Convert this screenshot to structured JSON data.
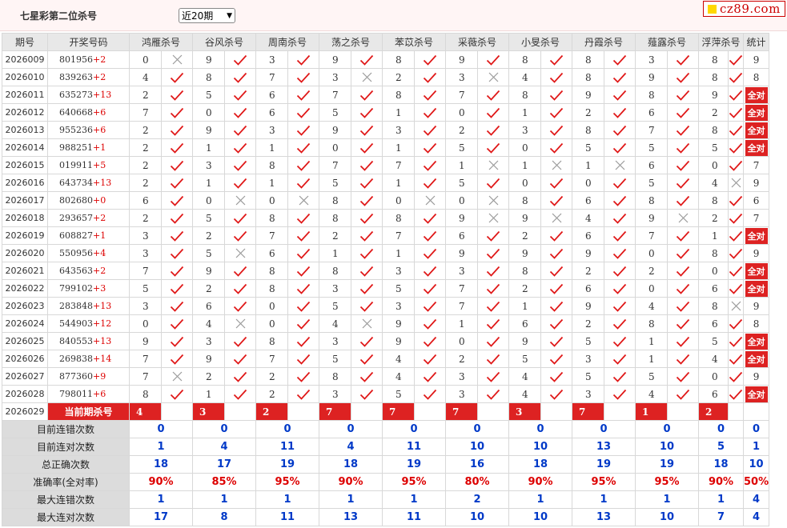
{
  "header": {
    "title": "七星彩第二位杀号",
    "period_select": "近20期",
    "logo_text": "cz89.com"
  },
  "table": {
    "headers": [
      "期号",
      "开奖号码",
      "鸿雁杀号",
      "谷风杀号",
      "周南杀号",
      "荡之杀号",
      "苯苡杀号",
      "采薇杀号",
      "小旻杀号",
      "丹霞杀号",
      "薤露杀号",
      "浮萍杀号",
      "统计"
    ],
    "rows": [
      {
        "period": "2026009",
        "digits": "801956",
        "add": "+2",
        "kills": [
          "0",
          "9",
          "3",
          "9",
          "8",
          "9",
          "8",
          "8",
          "3",
          "8"
        ],
        "marks": [
          0,
          1,
          1,
          1,
          1,
          1,
          1,
          1,
          1,
          1
        ],
        "stat": "9"
      },
      {
        "period": "2026010",
        "digits": "839263",
        "add": "+2",
        "kills": [
          "4",
          "8",
          "7",
          "3",
          "2",
          "3",
          "4",
          "8",
          "9",
          "8"
        ],
        "marks": [
          1,
          1,
          1,
          0,
          1,
          0,
          1,
          1,
          1,
          1
        ],
        "stat": "8"
      },
      {
        "period": "2026011",
        "digits": "635273",
        "add": "+13",
        "kills": [
          "2",
          "5",
          "6",
          "7",
          "8",
          "7",
          "8",
          "9",
          "8",
          "9"
        ],
        "marks": [
          1,
          1,
          1,
          1,
          1,
          1,
          1,
          1,
          1,
          1
        ],
        "stat": "全对"
      },
      {
        "period": "2026012",
        "digits": "640668",
        "add": "+6",
        "kills": [
          "7",
          "0",
          "6",
          "5",
          "1",
          "0",
          "1",
          "2",
          "6",
          "2"
        ],
        "marks": [
          1,
          1,
          1,
          1,
          1,
          1,
          1,
          1,
          1,
          1
        ],
        "stat": "全对"
      },
      {
        "period": "2026013",
        "digits": "955236",
        "add": "+6",
        "kills": [
          "2",
          "9",
          "3",
          "9",
          "3",
          "2",
          "3",
          "8",
          "7",
          "8"
        ],
        "marks": [
          1,
          1,
          1,
          1,
          1,
          1,
          1,
          1,
          1,
          1
        ],
        "stat": "全对"
      },
      {
        "period": "2026014",
        "digits": "988251",
        "add": "+1",
        "kills": [
          "2",
          "1",
          "1",
          "0",
          "1",
          "5",
          "0",
          "5",
          "5",
          "5"
        ],
        "marks": [
          1,
          1,
          1,
          1,
          1,
          1,
          1,
          1,
          1,
          1
        ],
        "stat": "全对"
      },
      {
        "period": "2026015",
        "digits": "019911",
        "add": "+5",
        "kills": [
          "2",
          "3",
          "8",
          "7",
          "7",
          "1",
          "1",
          "1",
          "6",
          "0"
        ],
        "marks": [
          1,
          1,
          1,
          1,
          1,
          0,
          0,
          0,
          1,
          1
        ],
        "stat": "7"
      },
      {
        "period": "2026016",
        "digits": "643734",
        "add": "+13",
        "kills": [
          "2",
          "1",
          "1",
          "5",
          "1",
          "5",
          "0",
          "0",
          "5",
          "4"
        ],
        "marks": [
          1,
          1,
          1,
          1,
          1,
          1,
          1,
          1,
          1,
          0
        ],
        "stat": "9"
      },
      {
        "period": "2026017",
        "digits": "802680",
        "add": "+0",
        "kills": [
          "6",
          "0",
          "0",
          "8",
          "0",
          "0",
          "8",
          "6",
          "8",
          "8"
        ],
        "marks": [
          1,
          0,
          0,
          1,
          0,
          0,
          1,
          1,
          1,
          1
        ],
        "stat": "6"
      },
      {
        "period": "2026018",
        "digits": "293657",
        "add": "+2",
        "kills": [
          "2",
          "5",
          "8",
          "8",
          "8",
          "9",
          "9",
          "4",
          "9",
          "2"
        ],
        "marks": [
          1,
          1,
          1,
          1,
          1,
          0,
          0,
          1,
          0,
          1
        ],
        "stat": "7"
      },
      {
        "period": "2026019",
        "digits": "608827",
        "add": "+1",
        "kills": [
          "3",
          "2",
          "7",
          "2",
          "7",
          "6",
          "2",
          "6",
          "7",
          "1"
        ],
        "marks": [
          1,
          1,
          1,
          1,
          1,
          1,
          1,
          1,
          1,
          1
        ],
        "stat": "全对"
      },
      {
        "period": "2026020",
        "digits": "550956",
        "add": "+4",
        "kills": [
          "3",
          "5",
          "6",
          "1",
          "1",
          "9",
          "9",
          "9",
          "0",
          "8"
        ],
        "marks": [
          1,
          0,
          1,
          1,
          1,
          1,
          1,
          1,
          1,
          1
        ],
        "stat": "9"
      },
      {
        "period": "2026021",
        "digits": "643563",
        "add": "+2",
        "kills": [
          "7",
          "9",
          "8",
          "8",
          "3",
          "3",
          "8",
          "2",
          "2",
          "0"
        ],
        "marks": [
          1,
          1,
          1,
          1,
          1,
          1,
          1,
          1,
          1,
          1
        ],
        "stat": "全对"
      },
      {
        "period": "2026022",
        "digits": "799102",
        "add": "+3",
        "kills": [
          "5",
          "2",
          "8",
          "3",
          "5",
          "7",
          "2",
          "6",
          "0",
          "6"
        ],
        "marks": [
          1,
          1,
          1,
          1,
          1,
          1,
          1,
          1,
          1,
          1
        ],
        "stat": "全对"
      },
      {
        "period": "2026023",
        "digits": "283848",
        "add": "+13",
        "kills": [
          "3",
          "6",
          "0",
          "5",
          "3",
          "7",
          "1",
          "9",
          "4",
          "8"
        ],
        "marks": [
          1,
          1,
          1,
          1,
          1,
          1,
          1,
          1,
          1,
          0
        ],
        "stat": "9"
      },
      {
        "period": "2026024",
        "digits": "544903",
        "add": "+12",
        "kills": [
          "0",
          "4",
          "0",
          "4",
          "9",
          "1",
          "6",
          "2",
          "8",
          "6"
        ],
        "marks": [
          1,
          0,
          1,
          0,
          1,
          1,
          1,
          1,
          1,
          1
        ],
        "stat": "8"
      },
      {
        "period": "2026025",
        "digits": "840553",
        "add": "+13",
        "kills": [
          "9",
          "3",
          "8",
          "3",
          "9",
          "0",
          "9",
          "5",
          "1",
          "5"
        ],
        "marks": [
          1,
          1,
          1,
          1,
          1,
          1,
          1,
          1,
          1,
          1
        ],
        "stat": "全对"
      },
      {
        "period": "2026026",
        "digits": "269838",
        "add": "+14",
        "kills": [
          "7",
          "9",
          "7",
          "5",
          "4",
          "2",
          "5",
          "3",
          "1",
          "4"
        ],
        "marks": [
          1,
          1,
          1,
          1,
          1,
          1,
          1,
          1,
          1,
          1
        ],
        "stat": "全对"
      },
      {
        "period": "2026027",
        "digits": "877360",
        "add": "+9",
        "kills": [
          "7",
          "2",
          "2",
          "8",
          "4",
          "3",
          "4",
          "5",
          "5",
          "0"
        ],
        "marks": [
          0,
          1,
          1,
          1,
          1,
          1,
          1,
          1,
          1,
          1
        ],
        "stat": "9"
      },
      {
        "period": "2026028",
        "digits": "798011",
        "add": "+6",
        "kills": [
          "8",
          "1",
          "2",
          "3",
          "5",
          "3",
          "4",
          "3",
          "4",
          "6"
        ],
        "marks": [
          1,
          1,
          1,
          1,
          1,
          1,
          1,
          1,
          1,
          1
        ],
        "stat": "全对"
      }
    ],
    "current": {
      "period": "2026029",
      "label": "当前期杀号",
      "kills": [
        "4",
        "3",
        "2",
        "7",
        "7",
        "7",
        "3",
        "7",
        "1",
        "2"
      ]
    },
    "summary": [
      {
        "label": "目前连错次数",
        "values": [
          "0",
          "0",
          "0",
          "0",
          "0",
          "0",
          "0",
          "0",
          "0",
          "0",
          "0"
        ]
      },
      {
        "label": "目前连对次数",
        "values": [
          "1",
          "4",
          "11",
          "4",
          "11",
          "10",
          "10",
          "13",
          "10",
          "5",
          "1"
        ]
      },
      {
        "label": "总正确次数",
        "values": [
          "18",
          "17",
          "19",
          "18",
          "19",
          "16",
          "18",
          "19",
          "19",
          "18",
          "10"
        ]
      },
      {
        "label": "准确率(全对率)",
        "values": [
          "90%",
          "85%",
          "95%",
          "90%",
          "95%",
          "80%",
          "90%",
          "95%",
          "95%",
          "90%",
          "50%"
        ],
        "red": true
      },
      {
        "label": "最大连错次数",
        "values": [
          "1",
          "1",
          "1",
          "1",
          "1",
          "2",
          "1",
          "1",
          "1",
          "1",
          "4"
        ]
      },
      {
        "label": "最大连对次数",
        "values": [
          "17",
          "8",
          "11",
          "13",
          "11",
          "10",
          "10",
          "13",
          "10",
          "7",
          "4"
        ]
      }
    ]
  },
  "colors": {
    "accent": "#d22222",
    "check": "#e01818",
    "cross": "#9a9a9a",
    "summary_value": "#0039c8",
    "header_bg": "#e8e8e8"
  },
  "icons": {
    "correct": "check-icon",
    "wrong": "cross-icon",
    "logo": "yellow-square-icon"
  }
}
